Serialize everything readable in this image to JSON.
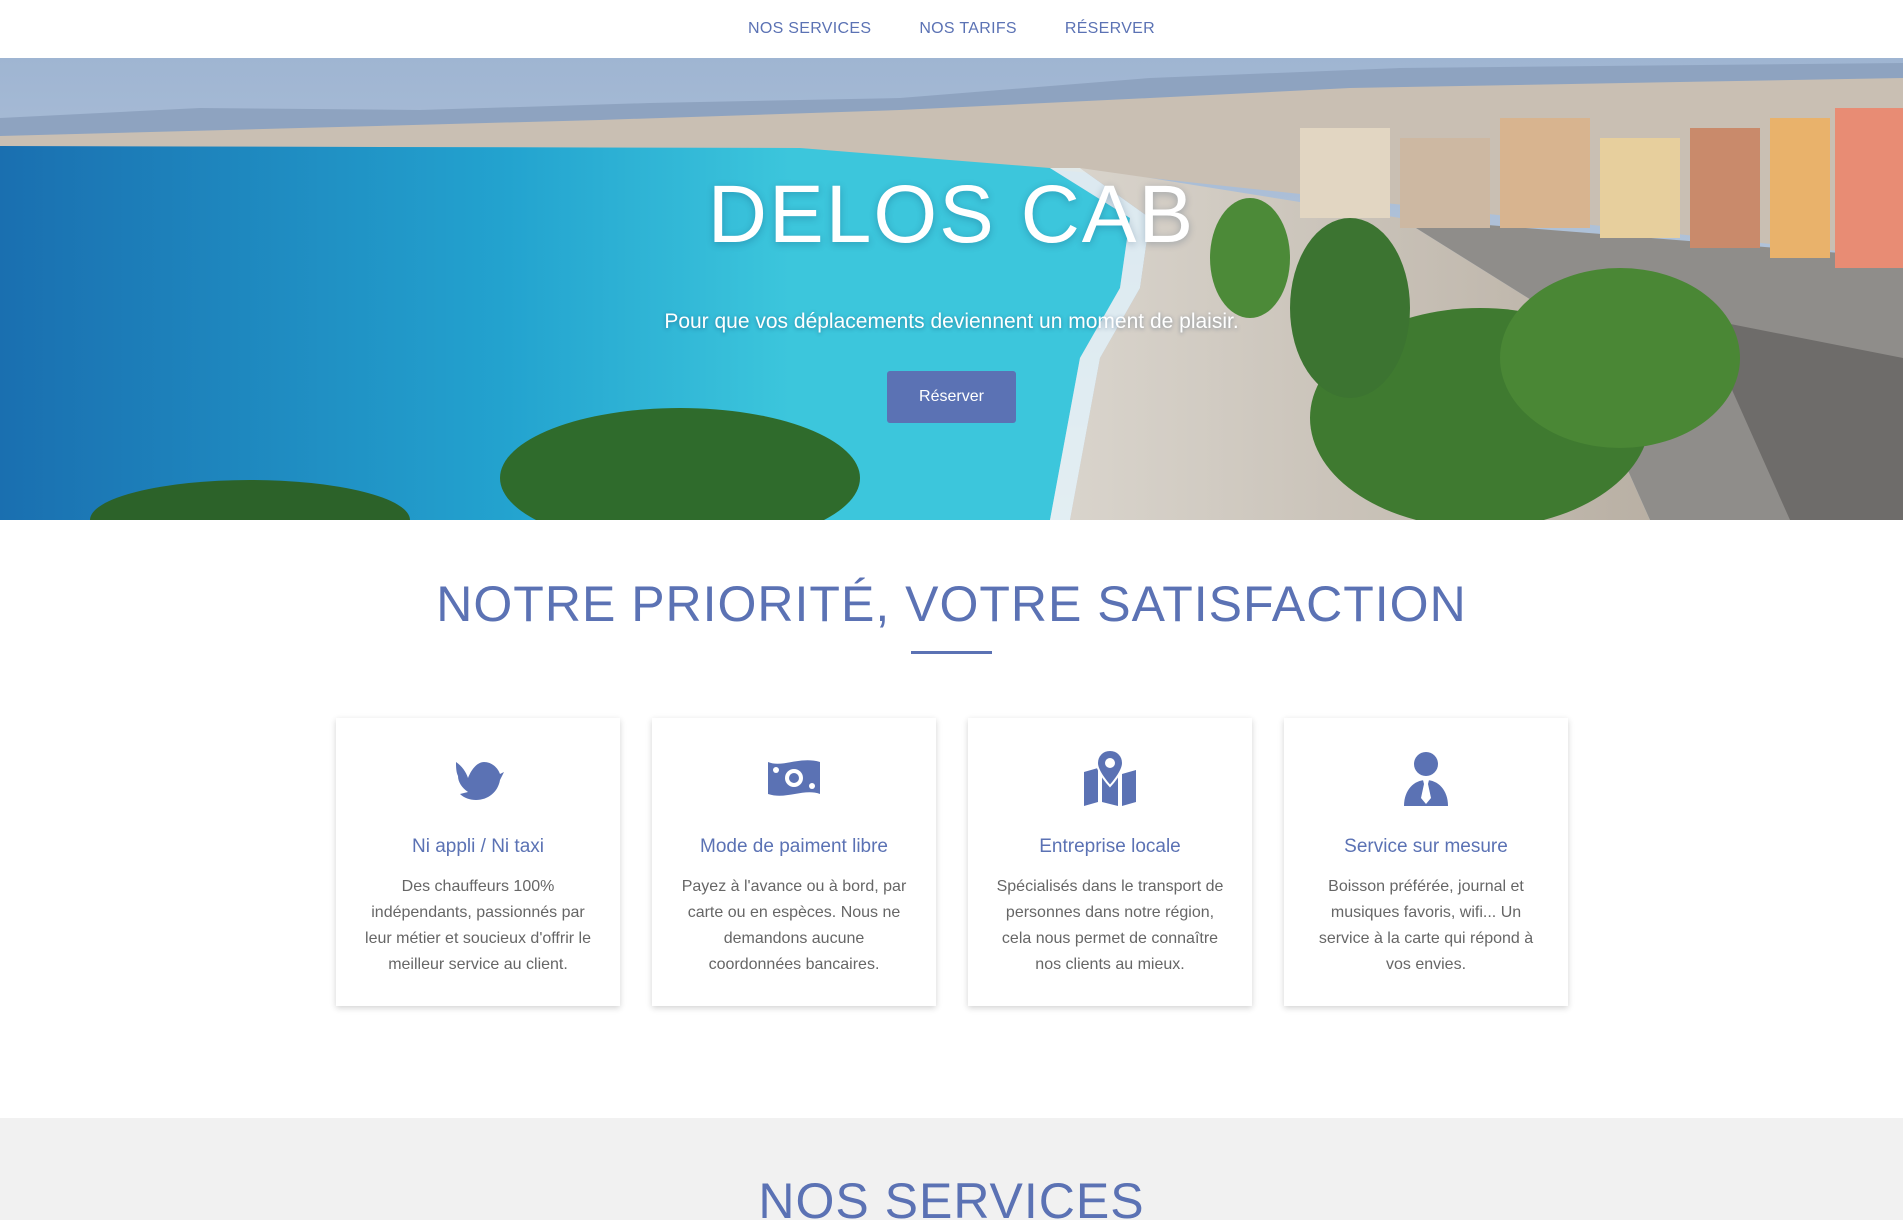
{
  "nav": {
    "items": [
      "NOS SERVICES",
      "NOS TARIFS",
      "RÉSERVER"
    ]
  },
  "hero": {
    "title": "DELOS CAB",
    "subtitle": "Pour que vos déplacements deviennent un moment de plaisir.",
    "button": "Réserver"
  },
  "priority": {
    "title": "NOTRE PRIORITÉ, VOTRE SATISFACTION",
    "cards": [
      {
        "icon": "dove-icon",
        "title": "Ni appli / Ni taxi",
        "text": "Des chauffeurs 100% indépendants, passionnés par leur métier et soucieux d'offrir le meilleur service au client."
      },
      {
        "icon": "money-bill-icon",
        "title": "Mode de paiment libre",
        "text": "Payez à l'avance ou à bord, par carte ou en espèces. Nous ne demandons aucune coordonnées bancaires."
      },
      {
        "icon": "map-marked-icon",
        "title": "Entreprise locale",
        "text": "Spécialisés dans le transport de personnes dans notre région, cela nous permet de connaître nos clients au mieux."
      },
      {
        "icon": "user-tie-icon",
        "title": "Service sur mesure",
        "text": "Boisson préférée, journal et musiques favoris, wifi... Un service à la carte qui répond à vos envies."
      }
    ]
  },
  "services": {
    "title": "NOS SERVICES"
  },
  "colors": {
    "accent": "#5b72b4",
    "sea": "#1fa6c9",
    "section_grey": "#f1f1f1"
  }
}
